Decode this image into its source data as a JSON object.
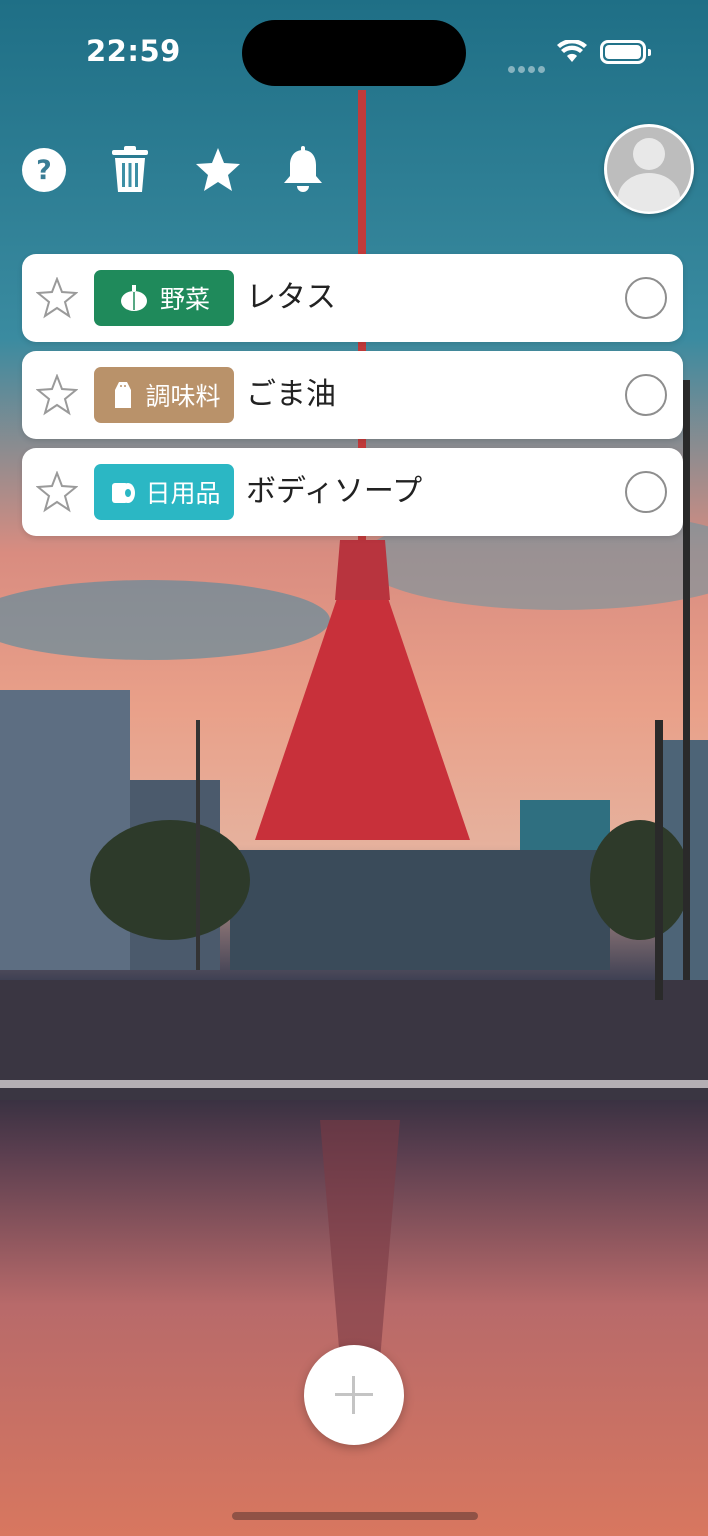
{
  "status_bar": {
    "time": "22:59"
  },
  "toolbar": {
    "icons": [
      "help-icon",
      "trash-icon",
      "favorites-star-icon",
      "notification-bell-icon"
    ]
  },
  "items": [
    {
      "category": "野菜",
      "category_icon": "pumpkin-icon",
      "color": "#1f8a5b",
      "name": "レタス"
    },
    {
      "category": "調味料",
      "category_icon": "salt-shaker-icon",
      "color": "#b9926a",
      "name": "ごま油"
    },
    {
      "category": "日用品",
      "category_icon": "toilet-paper-icon",
      "color": "#2bb7c4",
      "name": "ボディソープ"
    }
  ],
  "colors": {
    "card": "#ffffff",
    "icon_white": "#ffffff"
  }
}
